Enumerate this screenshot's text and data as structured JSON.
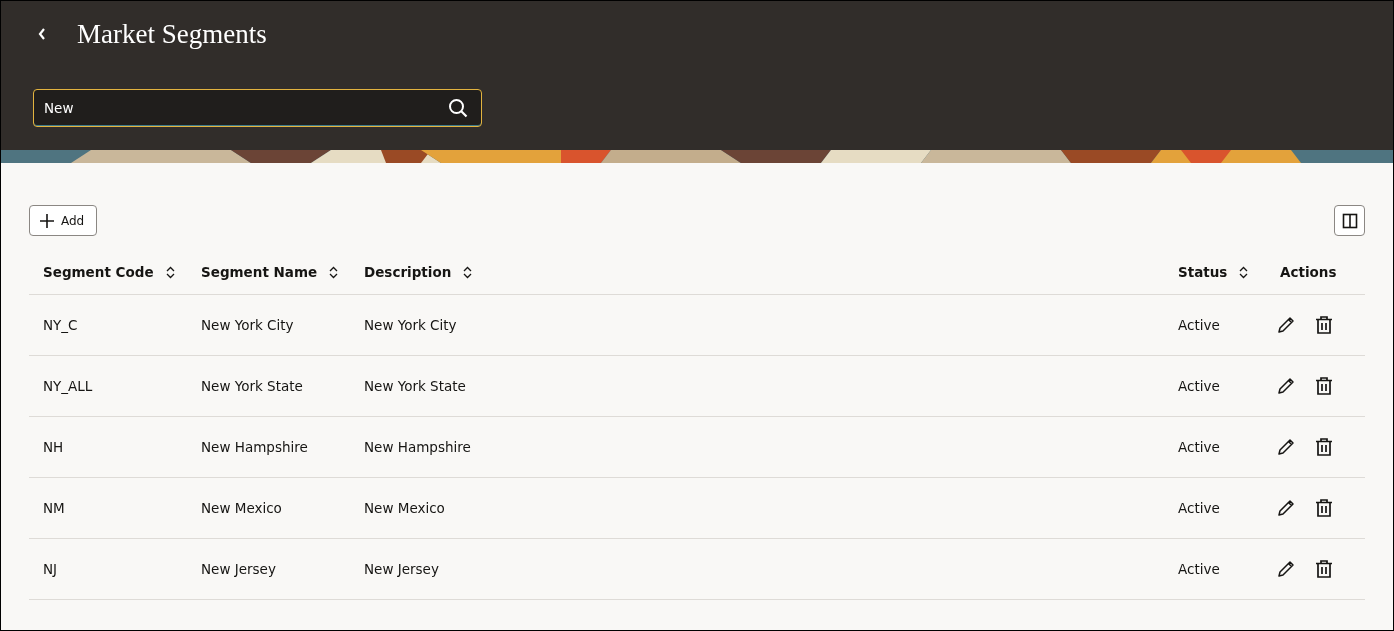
{
  "header": {
    "title": "Market Segments"
  },
  "search": {
    "value": "New"
  },
  "toolbar": {
    "add_label": "Add"
  },
  "table": {
    "columns": [
      {
        "label": "Segment Code",
        "sortable": true
      },
      {
        "label": "Segment Name",
        "sortable": true
      },
      {
        "label": "Description",
        "sortable": true
      },
      {
        "label": "Status",
        "sortable": true
      },
      {
        "label": "Actions",
        "sortable": false
      }
    ],
    "rows": [
      {
        "code": "NY_C",
        "name": "New York City",
        "description": "New York City",
        "status": "Active"
      },
      {
        "code": "NY_ALL",
        "name": "New York State",
        "description": "New York State",
        "status": "Active"
      },
      {
        "code": "NH",
        "name": "New Hampshire",
        "description": "New Hampshire",
        "status": "Active"
      },
      {
        "code": "NM",
        "name": "New Mexico",
        "description": "New Mexico",
        "status": "Active"
      },
      {
        "code": "NJ",
        "name": "New Jersey",
        "description": "New Jersey",
        "status": "Active"
      }
    ]
  }
}
